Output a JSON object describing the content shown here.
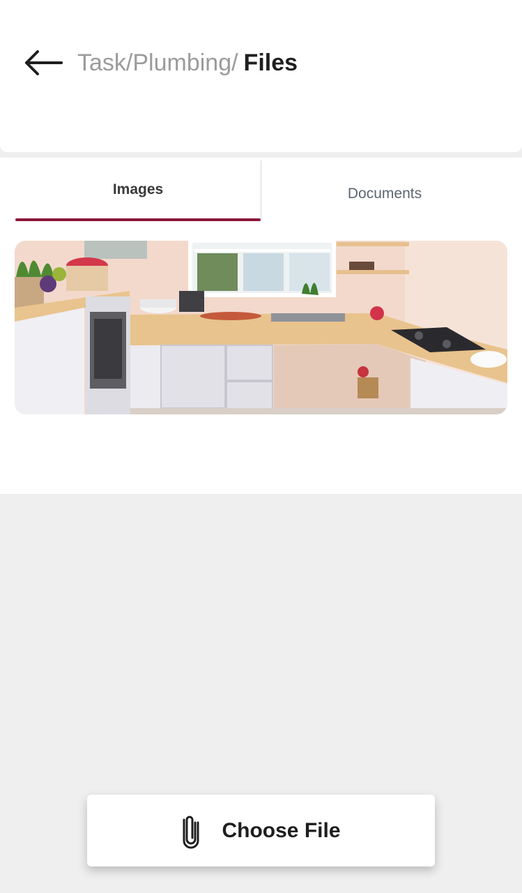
{
  "header": {
    "back_icon": "arrow-left-icon",
    "breadcrumb_path": "Task/Plumbing/",
    "breadcrumb_current": "Files"
  },
  "tabs": [
    {
      "label": "Images",
      "active": true
    },
    {
      "label": "Documents",
      "active": false
    }
  ],
  "images": [
    {
      "subject": "kitchen photo"
    }
  ],
  "action": {
    "label": "Choose File",
    "icon": "paperclip-icon"
  },
  "colors": {
    "accent": "#8a1838",
    "background": "#efefef"
  }
}
